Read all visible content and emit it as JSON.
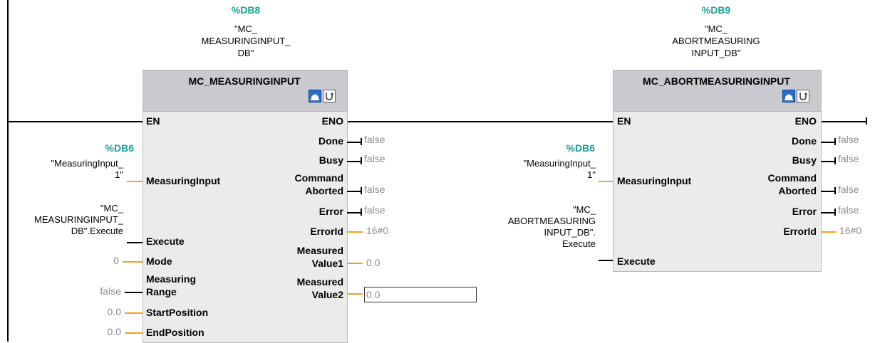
{
  "block1": {
    "db_number": "%DB8",
    "db_name_lines": [
      "\"MC_",
      "MEASURINGINPUT_",
      "DB\""
    ],
    "title": "MC_MEASURINGINPUT",
    "en": "EN",
    "eno": "ENO",
    "inputs": {
      "measuring_input": "MeasuringInput",
      "execute": "Execute",
      "mode": "Mode",
      "measuring_range_lines": [
        "Measuring",
        "Range"
      ],
      "start_position": "StartPosition",
      "end_position": "EndPosition"
    },
    "input_values": {
      "measuring_input_db": "%DB6",
      "measuring_input_lines": [
        "\"MeasuringInput_",
        "1\""
      ],
      "execute_lines": [
        "\"MC_",
        "MEASURINGINPUT_",
        "DB\".Execute"
      ],
      "mode": "0",
      "measuring_range": "false",
      "start_position": "0.0",
      "end_position": "0.0"
    },
    "outputs": {
      "done": "Done",
      "busy": "Busy",
      "command_aborted_lines": [
        "Command",
        "Aborted"
      ],
      "error": "Error",
      "error_id": "ErrorId",
      "measured_value1_lines": [
        "Measured",
        "Value1"
      ],
      "measured_value2_lines": [
        "Measured",
        "Value2"
      ]
    },
    "output_values": {
      "done": "false",
      "busy": "false",
      "command_aborted": "false",
      "error": "false",
      "error_id": "16#0",
      "measured_value1": "0.0",
      "measured_value2": "0.0"
    }
  },
  "block2": {
    "db_number": "%DB9",
    "db_name_lines": [
      "\"MC_",
      "ABORTMEASURING",
      "INPUT_DB\""
    ],
    "title": "MC_ABORTMEASURINGINPUT",
    "en": "EN",
    "eno": "ENO",
    "inputs": {
      "measuring_input": "MeasuringInput",
      "execute": "Execute"
    },
    "input_values": {
      "measuring_input_db": "%DB6",
      "measuring_input_lines": [
        "\"MeasuringInput_",
        "1\""
      ],
      "execute_lines": [
        "\"MC_",
        "ABORTMEASURING",
        "INPUT_DB\".",
        "Execute"
      ]
    },
    "outputs": {
      "done": "Done",
      "busy": "Busy",
      "command_aborted_lines": [
        "Command",
        "Aborted"
      ],
      "error": "Error",
      "error_id": "ErrorId"
    },
    "output_values": {
      "done": "false",
      "busy": "false",
      "command_aborted": "false",
      "error": "false",
      "error_id": "16#0"
    }
  },
  "colors": {
    "db_number": "#1aa39a",
    "wire": "#000000",
    "value_wire": "#f5a21a",
    "value_text": "#8c8c8c",
    "block_body": "#ebebeb",
    "block_header": "#c9c9cf"
  },
  "icons": [
    "online-monitor-icon",
    "diagnostics-icon"
  ]
}
